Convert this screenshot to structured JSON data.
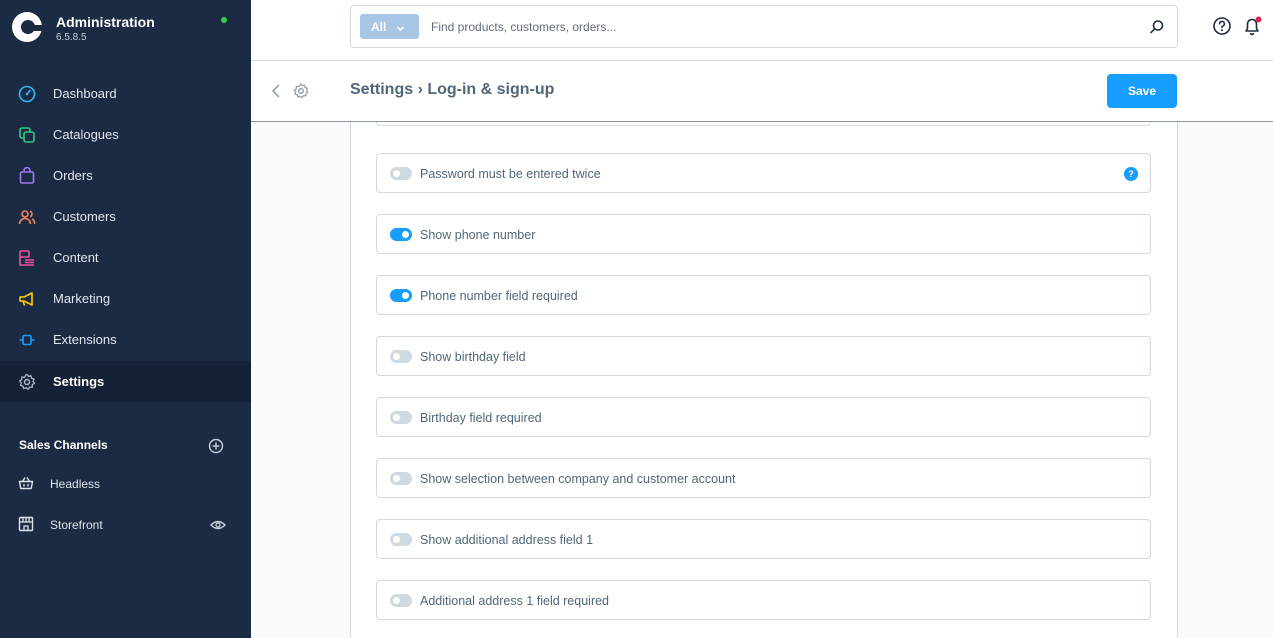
{
  "brand": {
    "title": "Administration",
    "version": "6.5.8.5"
  },
  "sidebar": {
    "items": [
      {
        "label": "Dashboard",
        "icon": "dashboard-icon",
        "color": "#2fb8f7"
      },
      {
        "label": "Catalogues",
        "icon": "catalogues-icon",
        "color": "#33c87e"
      },
      {
        "label": "Orders",
        "icon": "orders-icon",
        "color": "#9b7bf2"
      },
      {
        "label": "Customers",
        "icon": "customers-icon",
        "color": "#f2875b"
      },
      {
        "label": "Content",
        "icon": "content-icon",
        "color": "#ef4f9e"
      },
      {
        "label": "Marketing",
        "icon": "marketing-icon",
        "color": "#ffd200"
      },
      {
        "label": "Extensions",
        "icon": "extensions-icon",
        "color": "#189eff"
      },
      {
        "label": "Settings",
        "icon": "settings-icon",
        "color": "#a9b7c6"
      }
    ],
    "sales_channels": {
      "title": "Sales Channels",
      "items": [
        {
          "label": "Headless",
          "icon": "basket-icon"
        },
        {
          "label": "Storefront",
          "icon": "storefront-icon"
        }
      ]
    }
  },
  "search": {
    "type_label": "All",
    "placeholder": "Find products, customers, orders..."
  },
  "smartbar": {
    "title": "Settings › Log-in & sign-up",
    "save_label": "Save"
  },
  "fields": [
    {
      "label": "Password must be entered twice",
      "enabled": false,
      "help": true
    },
    {
      "label": "Show phone number",
      "enabled": true
    },
    {
      "label": "Phone number field required",
      "enabled": true
    },
    {
      "label": "Show birthday field",
      "enabled": false
    },
    {
      "label": "Birthday field required",
      "enabled": false
    },
    {
      "label": "Show selection between company and customer account",
      "enabled": false
    },
    {
      "label": "Show additional address field 1",
      "enabled": false
    },
    {
      "label": "Additional address 1 field required",
      "enabled": false
    }
  ],
  "help_badge": "?",
  "colors": {
    "sidebar_bg": "#1b2b43",
    "accent": "#189eff",
    "status_online": "#37d046",
    "notification": "#de294c"
  }
}
